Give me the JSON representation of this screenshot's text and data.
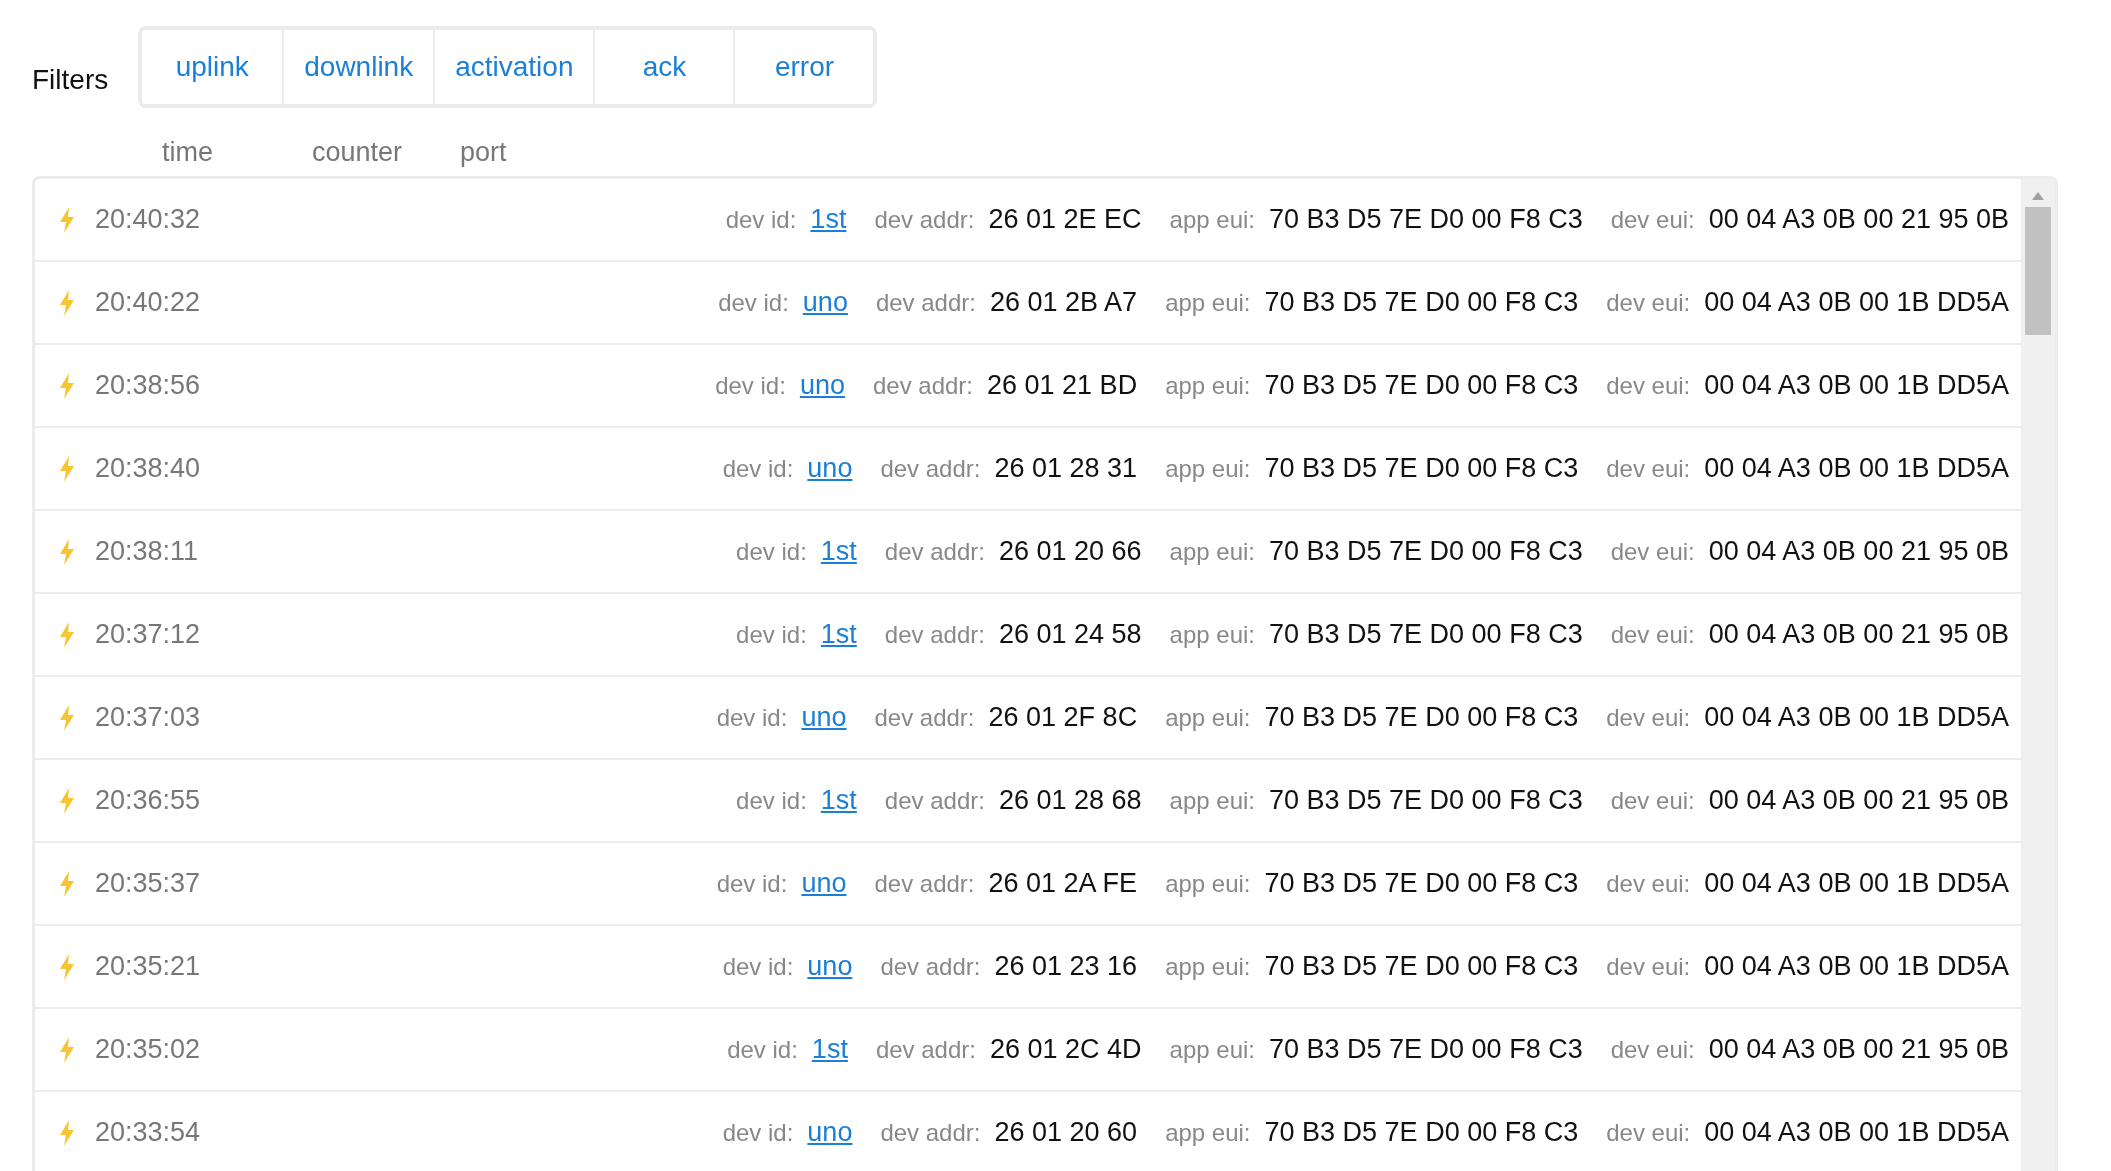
{
  "filters": {
    "label": "Filters",
    "buttons": [
      "uplink",
      "downlink",
      "activation",
      "ack",
      "error"
    ]
  },
  "columns": [
    "time",
    "counter",
    "port"
  ],
  "rows": [
    {
      "time": "20:40:32",
      "fields": [
        {
          "kind": "link",
          "label": "dev id:",
          "value": "1st"
        },
        {
          "kind": "text",
          "label": "dev addr:",
          "value": "26 01 2E EC"
        },
        {
          "kind": "text",
          "label": "app eui:",
          "value": "70 B3 D5 7E D0 00 F8 C3"
        },
        {
          "kind": "text",
          "label": "dev eui:",
          "value": "00 04 A3 0B 00 21 95 0B"
        }
      ]
    },
    {
      "time": "20:40:22",
      "fields": [
        {
          "kind": "link",
          "label": "dev id:",
          "value": "uno"
        },
        {
          "kind": "text",
          "label": "dev addr:",
          "value": "26 01 2B A7"
        },
        {
          "kind": "text",
          "label": "app eui:",
          "value": "70 B3 D5 7E D0 00 F8 C3"
        },
        {
          "kind": "text",
          "label": "dev eui:",
          "value": "00 04 A3 0B 00 1B DD5A"
        }
      ]
    },
    {
      "time": "20:38:56",
      "fields": [
        {
          "kind": "link",
          "label": "dev id:",
          "value": "uno"
        },
        {
          "kind": "text",
          "label": "dev addr:",
          "value": "26 01 21 BD"
        },
        {
          "kind": "text",
          "label": "app eui:",
          "value": "70 B3 D5 7E D0 00 F8 C3"
        },
        {
          "kind": "text",
          "label": "dev eui:",
          "value": "00 04 A3 0B 00 1B DD5A"
        }
      ]
    },
    {
      "time": "20:38:40",
      "fields": [
        {
          "kind": "link",
          "label": "dev id:",
          "value": "uno"
        },
        {
          "kind": "text",
          "label": "dev addr:",
          "value": "26 01 28 31"
        },
        {
          "kind": "text",
          "label": "app eui:",
          "value": "70 B3 D5 7E D0 00 F8 C3"
        },
        {
          "kind": "text",
          "label": "dev eui:",
          "value": "00 04 A3 0B 00 1B DD5A"
        }
      ]
    },
    {
      "time": "20:38:11",
      "fields": [
        {
          "kind": "link",
          "label": "dev id:",
          "value": "1st"
        },
        {
          "kind": "text",
          "label": "dev addr:",
          "value": "26 01 20 66"
        },
        {
          "kind": "text",
          "label": "app eui:",
          "value": "70 B3 D5 7E D0 00 F8 C3"
        },
        {
          "kind": "text",
          "label": "dev eui:",
          "value": "00 04 A3 0B 00 21 95 0B"
        }
      ]
    },
    {
      "time": "20:37:12",
      "fields": [
        {
          "kind": "link",
          "label": "dev id:",
          "value": "1st"
        },
        {
          "kind": "text",
          "label": "dev addr:",
          "value": "26 01 24 58"
        },
        {
          "kind": "text",
          "label": "app eui:",
          "value": "70 B3 D5 7E D0 00 F8 C3"
        },
        {
          "kind": "text",
          "label": "dev eui:",
          "value": "00 04 A3 0B 00 21 95 0B"
        }
      ]
    },
    {
      "time": "20:37:03",
      "fields": [
        {
          "kind": "link",
          "label": "dev id:",
          "value": "uno"
        },
        {
          "kind": "text",
          "label": "dev addr:",
          "value": "26 01 2F 8C"
        },
        {
          "kind": "text",
          "label": "app eui:",
          "value": "70 B3 D5 7E D0 00 F8 C3"
        },
        {
          "kind": "text",
          "label": "dev eui:",
          "value": "00 04 A3 0B 00 1B DD5A"
        }
      ]
    },
    {
      "time": "20:36:55",
      "fields": [
        {
          "kind": "link",
          "label": "dev id:",
          "value": "1st"
        },
        {
          "kind": "text",
          "label": "dev addr:",
          "value": "26 01 28 68"
        },
        {
          "kind": "text",
          "label": "app eui:",
          "value": "70 B3 D5 7E D0 00 F8 C3"
        },
        {
          "kind": "text",
          "label": "dev eui:",
          "value": "00 04 A3 0B 00 21 95 0B"
        }
      ]
    },
    {
      "time": "20:35:37",
      "fields": [
        {
          "kind": "link",
          "label": "dev id:",
          "value": "uno"
        },
        {
          "kind": "text",
          "label": "dev addr:",
          "value": "26 01 2A FE"
        },
        {
          "kind": "text",
          "label": "app eui:",
          "value": "70 B3 D5 7E D0 00 F8 C3"
        },
        {
          "kind": "text",
          "label": "dev eui:",
          "value": "00 04 A3 0B 00 1B DD5A"
        }
      ]
    },
    {
      "time": "20:35:21",
      "fields": [
        {
          "kind": "link",
          "label": "dev id:",
          "value": "uno"
        },
        {
          "kind": "text",
          "label": "dev addr:",
          "value": "26 01 23 16"
        },
        {
          "kind": "text",
          "label": "app eui:",
          "value": "70 B3 D5 7E D0 00 F8 C3"
        },
        {
          "kind": "text",
          "label": "dev eui:",
          "value": "00 04 A3 0B 00 1B DD5A"
        }
      ]
    },
    {
      "time": "20:35:02",
      "fields": [
        {
          "kind": "link",
          "label": "dev id:",
          "value": "1st"
        },
        {
          "kind": "text",
          "label": "dev addr:",
          "value": "26 01 2C 4D"
        },
        {
          "kind": "text",
          "label": "app eui:",
          "value": "70 B3 D5 7E D0 00 F8 C3"
        },
        {
          "kind": "text",
          "label": "dev eui:",
          "value": "00 04 A3 0B 00 21 95 0B"
        }
      ]
    },
    {
      "time": "20:33:54",
      "fields": [
        {
          "kind": "link",
          "label": "dev id:",
          "value": "uno"
        },
        {
          "kind": "text",
          "label": "dev addr:",
          "value": "26 01 20 60"
        },
        {
          "kind": "text",
          "label": "app eui:",
          "value": "70 B3 D5 7E D0 00 F8 C3"
        },
        {
          "kind": "text",
          "label": "dev eui:",
          "value": "00 04 A3 0B 00 1B DD5A"
        }
      ]
    }
  ]
}
